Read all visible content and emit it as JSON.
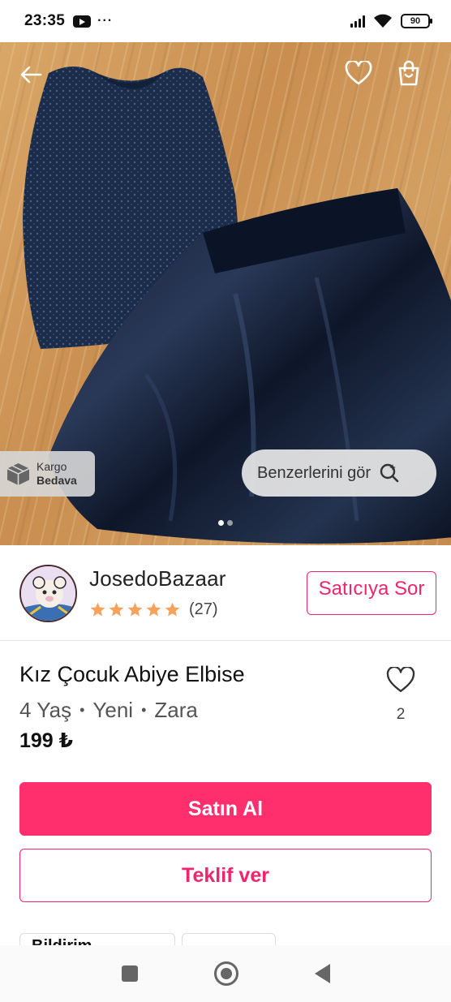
{
  "status_bar": {
    "time": "23:35",
    "more": "···",
    "battery": "90",
    "icons": [
      "youtube-icon",
      "signal-icon",
      "wifi-icon",
      "battery-icon"
    ]
  },
  "photo": {
    "cargo_line1": "Kargo",
    "cargo_line2": "Bedava",
    "similar_label": "Benzerlerini gör",
    "slide_count": 2,
    "active_slide": 1
  },
  "seller": {
    "name": "JosedoBazaar",
    "rating": 5,
    "rating_count": "(27)",
    "contact_label": "Satıcıya Sor"
  },
  "product": {
    "title": "Kız Çocuk Abiye Elbise",
    "size": "4 Yaş",
    "condition": "Yeni",
    "brand": "Zara",
    "price": "199 ₺",
    "like_count": "2"
  },
  "actions": {
    "buy_label": "Satın Al",
    "offer_label": "Teklif ver"
  },
  "chips": [
    "Bildirim",
    ""
  ],
  "colors": {
    "accent": "#ff2f6e",
    "accent_border": "#f0256a",
    "star": "#f5a25d"
  }
}
